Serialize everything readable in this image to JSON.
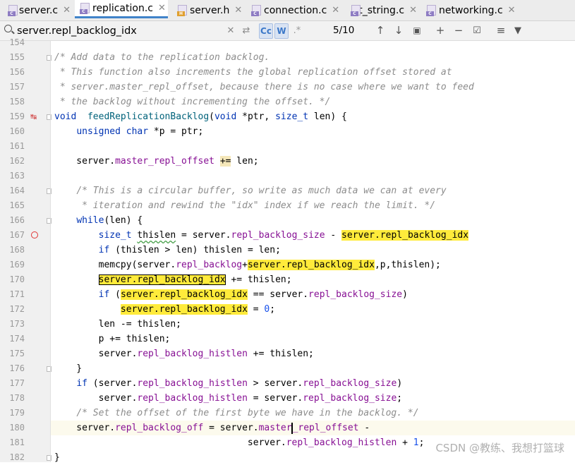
{
  "tabs": [
    {
      "label": "server.c",
      "type": "c",
      "active": false
    },
    {
      "label": "replication.c",
      "type": "c",
      "active": true
    },
    {
      "label": "server.h",
      "type": "h",
      "active": false
    },
    {
      "label": "connection.c",
      "type": "c",
      "active": false
    },
    {
      "label": "t_string.c",
      "type": "c",
      "active": false
    },
    {
      "label": "networking.c",
      "type": "c",
      "active": false
    }
  ],
  "search": {
    "query": "server.repl_backlog_idx",
    "match_case_label": "Cc",
    "words_label": "W",
    "regex_label": ".*",
    "counter": "5/10"
  },
  "line_numbers": [
    "154",
    "155",
    "156",
    "157",
    "158",
    "159",
    "160",
    "161",
    "162",
    "163",
    "164",
    "165",
    "166",
    "167",
    "168",
    "169",
    "170",
    "171",
    "172",
    "173",
    "174",
    "175",
    "176",
    "177",
    "178",
    "179",
    "180",
    "181",
    "182"
  ],
  "code_lines": [
    [
      [
        "",
        "           "
      ]
    ],
    [
      [
        "cm",
        "/* Add data to the replication backlog."
      ]
    ],
    [
      [
        "cm",
        " * This function also increments the global replication offset stored at"
      ]
    ],
    [
      [
        "cm",
        " * server.master_repl_offset, because there is no case where we want to feed"
      ]
    ],
    [
      [
        "cm",
        " * the backlog without incrementing the offset. */"
      ]
    ],
    [
      [
        "kw",
        "void"
      ],
      [
        "",
        "  "
      ],
      [
        "fn",
        "feedReplicationBacklog"
      ],
      [
        "",
        "("
      ],
      [
        "kw",
        "void"
      ],
      [
        "",
        " *ptr, "
      ],
      [
        "kw",
        "size_t"
      ],
      [
        "",
        " len) {"
      ]
    ],
    [
      [
        "",
        "    "
      ],
      [
        "kw",
        "unsigned char"
      ],
      [
        "",
        " *p = ptr;"
      ]
    ],
    [
      [
        "",
        ""
      ]
    ],
    [
      [
        "",
        "    server."
      ],
      [
        "fl",
        "master_repl_offset"
      ],
      [
        "",
        " "
      ],
      [
        "pe",
        "+="
      ],
      [
        "",
        " len;"
      ]
    ],
    [
      [
        "",
        ""
      ]
    ],
    [
      [
        "",
        "    "
      ],
      [
        "cm",
        "/* This is a circular buffer, so write as much data we can at every"
      ]
    ],
    [
      [
        "",
        "    "
      ],
      [
        "cm",
        " * iteration and rewind the \"idx\" index if we reach the limit. */"
      ]
    ],
    [
      [
        "",
        "    "
      ],
      [
        "kw",
        "while"
      ],
      [
        "",
        "(len) {"
      ]
    ],
    [
      [
        "",
        "        "
      ],
      [
        "kw",
        "size_t"
      ],
      [
        "",
        " "
      ],
      [
        "uw",
        "thislen"
      ],
      [
        "",
        " = server."
      ],
      [
        "fl",
        "repl_backlog_size"
      ],
      [
        "",
        " - "
      ],
      [
        "hl",
        "server.repl_backlog_idx"
      ],
      [
        ";"
      ]
    ],
    [
      [
        "",
        "        "
      ],
      [
        "kw",
        "if"
      ],
      [
        "",
        " (thislen > len) thislen = len;"
      ]
    ],
    [
      [
        "",
        "        memcpy(server."
      ],
      [
        "fl",
        "repl_backlog"
      ],
      [
        "",
        "+"
      ],
      [
        "hl",
        "server.repl_backlog_idx"
      ],
      [
        "",
        ",p,thislen);"
      ]
    ],
    [
      [
        "",
        "        "
      ],
      [
        "hlb",
        "server.repl_backlog_idx"
      ],
      [
        "",
        " += thislen;"
      ]
    ],
    [
      [
        "",
        "        "
      ],
      [
        "kw",
        "if"
      ],
      [
        "",
        " ("
      ],
      [
        "hl",
        "server.repl_backlog_idx"
      ],
      [
        "",
        " == server."
      ],
      [
        "fl",
        "repl_backlog_size"
      ],
      [
        "",
        ")"
      ]
    ],
    [
      [
        "",
        "            "
      ],
      [
        "hl",
        "server.repl_backlog_idx"
      ],
      [
        "",
        " = "
      ],
      [
        "nm",
        "0"
      ],
      [
        "",
        ";"
      ]
    ],
    [
      [
        "",
        "        len -= thislen;"
      ]
    ],
    [
      [
        "",
        "        p += thislen;"
      ]
    ],
    [
      [
        "",
        "        server."
      ],
      [
        "fl",
        "repl_backlog_histlen"
      ],
      [
        "",
        " += thislen;"
      ]
    ],
    [
      [
        "",
        "    }"
      ]
    ],
    [
      [
        "",
        "    "
      ],
      [
        "kw",
        "if"
      ],
      [
        "",
        " (server."
      ],
      [
        "fl",
        "repl_backlog_histlen"
      ],
      [
        "",
        " > server."
      ],
      [
        "fl",
        "repl_backlog_size"
      ],
      [
        "",
        ")"
      ]
    ],
    [
      [
        "",
        "        server."
      ],
      [
        "fl",
        "repl_backlog_histlen"
      ],
      [
        "",
        " = server."
      ],
      [
        "fl",
        "repl_backlog_size"
      ],
      [
        "",
        ";"
      ]
    ],
    [
      [
        "",
        "    "
      ],
      [
        "cm",
        "/* Set the offset of the first byte we have in the backlog. */"
      ]
    ],
    [
      [
        "",
        "    server."
      ],
      [
        "fl",
        "repl_backlog_off"
      ],
      [
        "",
        " = server."
      ],
      [
        "fl",
        "master"
      ],
      [
        "caret",
        ""
      ],
      [
        "fl",
        "_repl_offset"
      ],
      [
        "",
        " -"
      ]
    ],
    [
      [
        "",
        "                                   server."
      ],
      [
        "fl",
        "repl_backlog_histlen"
      ],
      [
        "",
        " + "
      ],
      [
        "nm",
        "1"
      ],
      [
        "",
        ";"
      ]
    ],
    [
      [
        "",
        "}"
      ]
    ]
  ],
  "gutter_markers": {
    "override_line": "159",
    "breakpoint_line": "167",
    "caret_line": "180"
  },
  "watermark": "CSDN @教练、我想打篮球",
  "colors": {
    "keyword": "#0033b3",
    "function": "#00627a",
    "field": "#871094",
    "comment": "#8c8c8c",
    "number": "#1750eb",
    "match_highlight": "#ffeb3b",
    "active_tab_underline": "#4083c9"
  }
}
